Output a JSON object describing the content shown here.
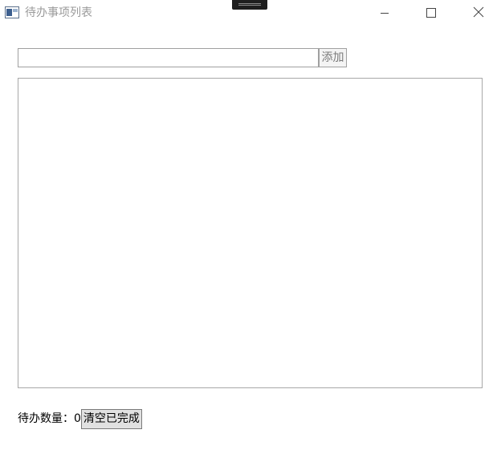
{
  "window": {
    "title": "待办事项列表"
  },
  "input": {
    "value": "",
    "placeholder": ""
  },
  "toolbar": {
    "add_label": "添加"
  },
  "list": {
    "items": []
  },
  "footer": {
    "count_label": "待办数量：",
    "count_value": "0",
    "clear_label": "清空已完成"
  },
  "icons": {
    "app": "app-window-icon",
    "minimize": "minimize-icon",
    "maximize": "maximize-icon",
    "close": "close-icon"
  }
}
